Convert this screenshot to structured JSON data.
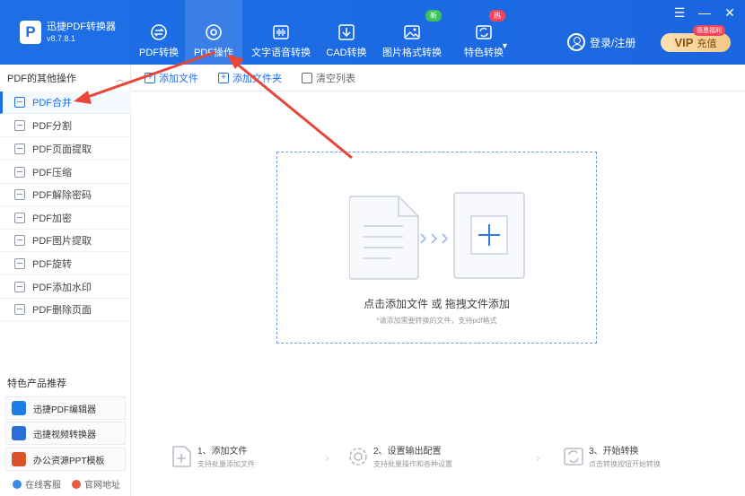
{
  "app": {
    "name": "迅捷PDF转换器",
    "version": "v8.7.8.1",
    "logo_letter": "P"
  },
  "nav": {
    "tabs": [
      {
        "label": "PDF转换",
        "icon": "convert-icon"
      },
      {
        "label": "PDF操作",
        "icon": "disc-icon",
        "active": true
      },
      {
        "label": "文字语音转换",
        "icon": "audio-wave-icon"
      },
      {
        "label": "CAD转换",
        "icon": "cad-icon"
      },
      {
        "label": "图片格式转换",
        "icon": "image-icon"
      },
      {
        "label": "特色转换",
        "icon": "refresh-icon"
      }
    ],
    "badge_new": "新",
    "badge_hot": "热"
  },
  "header": {
    "login_label": "登录/注册",
    "vip_big": "VIP",
    "vip_label": "充值",
    "vip_tag": "感恩福利",
    "menu": "☰",
    "minimize": "—",
    "close": "✕"
  },
  "sidebar": {
    "section_title": "PDF的其他操作",
    "collapse": "︿",
    "items": [
      {
        "label": "PDF合并",
        "active": true
      },
      {
        "label": "PDF分割"
      },
      {
        "label": "PDF页面提取"
      },
      {
        "label": "PDF压缩"
      },
      {
        "label": "PDF解除密码"
      },
      {
        "label": "PDF加密"
      },
      {
        "label": "PDF图片提取"
      },
      {
        "label": "PDF旋转"
      },
      {
        "label": "PDF添加水印"
      },
      {
        "label": "PDF删除页面"
      }
    ],
    "recommend_title": "特色产品推荐",
    "recommend": [
      {
        "label": "迅捷PDF编辑器",
        "color": "#1d7ee8"
      },
      {
        "label": "迅捷视频转换器",
        "color": "#2b6fd6"
      },
      {
        "label": "办公资源PPT模板",
        "color": "#d9542b"
      }
    ],
    "footer": [
      {
        "label": "在线客服",
        "color": "#3c8ae8"
      },
      {
        "label": "官网地址",
        "color": "#e85a3c"
      }
    ]
  },
  "toolbar": {
    "add_file": "添加文件",
    "add_folder": "添加文件夹",
    "clear_list": "清空列表"
  },
  "dropzone": {
    "main_text": "点击添加文件 或 拖拽文件添加",
    "hint": "*请添加需要转换的文件，支持pdf格式"
  },
  "steps": [
    {
      "title": "1、添加文件",
      "desc": "支持批量添加文件"
    },
    {
      "title": "2、设置输出配置",
      "desc": "支持批量操作和各种设置"
    },
    {
      "title": "3、开始转换",
      "desc": "点击转换按钮开始转换"
    }
  ],
  "colors": {
    "brand_blue": "#1d6de6",
    "annotation_red": "#e8463a"
  }
}
